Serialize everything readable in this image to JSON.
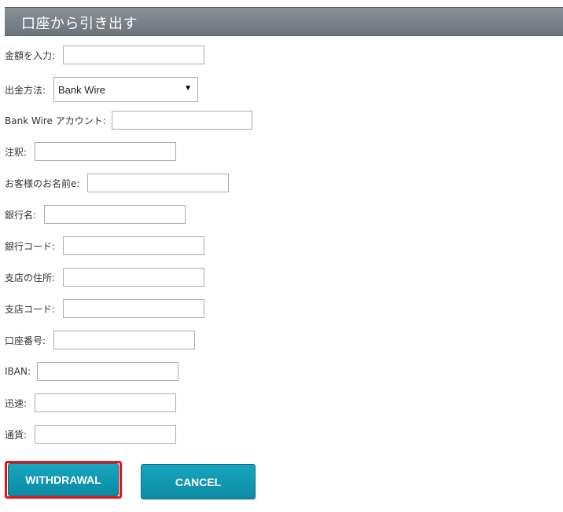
{
  "header": {
    "title": "口座から引き出す"
  },
  "form": {
    "amount_label": "金額を入力:",
    "method_label": "出金方法:",
    "method_selected": "Bank Wire",
    "account_label": "Bank Wire アカウント:",
    "notes_label": "注釈:",
    "customer_name_label": "お客様のお名前e:",
    "bank_name_label": "銀行名:",
    "bank_code_label": "銀行コード:",
    "branch_address_label": "支店の住所:",
    "branch_code_label": "支店コード:",
    "account_number_label": "口座番号:",
    "iban_label": "IBAN:",
    "swift_label": "迅速:",
    "currency_label": "通貨:"
  },
  "buttons": {
    "withdrawal": "WITHDRAWAL",
    "cancel": "CANCEL"
  },
  "colors": {
    "header_bg": "#7a8087",
    "button_bg": "#1199b3",
    "highlight": "#ee1111"
  }
}
